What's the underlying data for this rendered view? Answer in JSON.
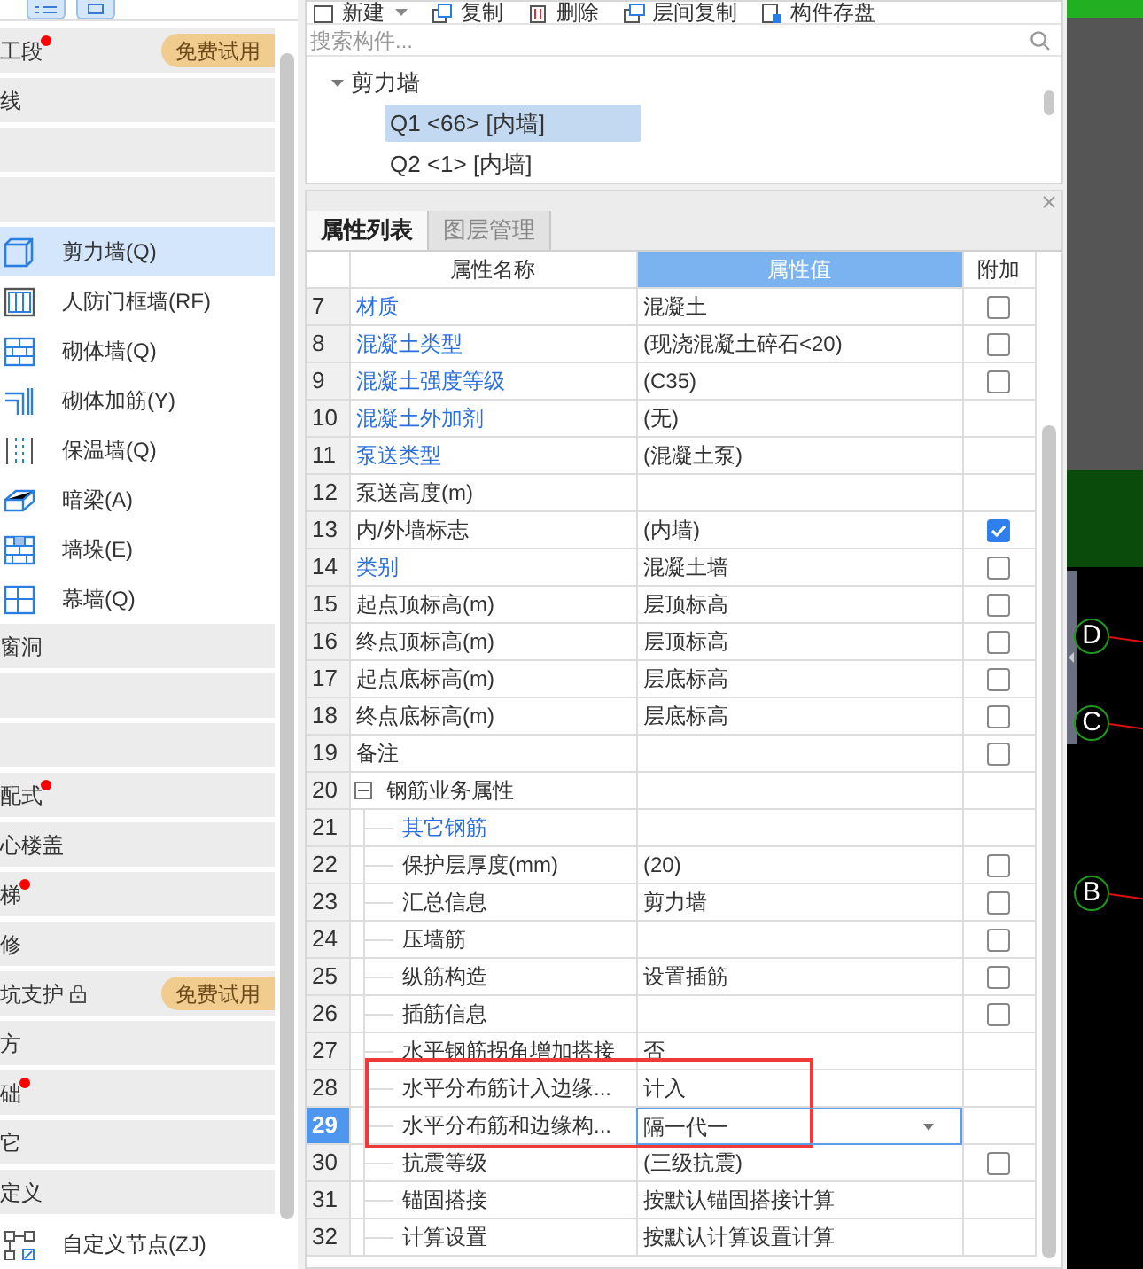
{
  "view_buttons": [
    {
      "kind": "list"
    },
    {
      "kind": "grid"
    }
  ],
  "nav": [
    {
      "kind": "category",
      "label": "工段",
      "dot": true,
      "lock": false,
      "badge": "免费试用"
    },
    {
      "kind": "category",
      "label": "线",
      "dot": false,
      "lock": false
    },
    {
      "kind": "category",
      "dot": false,
      "lock": false
    },
    {
      "kind": "category",
      "dot": false,
      "lock": false
    },
    {
      "kind": "box",
      "label": "剪力墙(Q)",
      "selected": true
    },
    {
      "kind": "frame",
      "label": "人防门框墙(RF)",
      "selected": false
    },
    {
      "kind": "brick",
      "label": "砌体墙(Q)",
      "selected": false
    },
    {
      "kind": "rebar",
      "label": "砌体加筋(Y)",
      "selected": false
    },
    {
      "kind": "dotted",
      "label": "保温墙(Q)",
      "selected": false
    },
    {
      "kind": "beam",
      "label": "暗梁(A)",
      "selected": false
    },
    {
      "kind": "pier",
      "label": "墙垛(E)",
      "selected": false
    },
    {
      "kind": "curtain",
      "label": "幕墙(Q)",
      "selected": false
    },
    {
      "kind": "category",
      "label": "窗洞",
      "dot": false,
      "lock": false
    },
    {
      "kind": "category",
      "dot": false,
      "lock": false
    },
    {
      "kind": "category",
      "dot": false,
      "lock": false
    },
    {
      "kind": "category",
      "label": "配式",
      "dot": true,
      "lock": false
    },
    {
      "kind": "category",
      "label": "心楼盖",
      "dot": false,
      "lock": false
    },
    {
      "kind": "category",
      "label": "梯",
      "dot": true,
      "lock": false
    },
    {
      "kind": "category",
      "label": "修",
      "dot": false,
      "lock": false
    },
    {
      "kind": "category",
      "label": "坑支护",
      "dot": false,
      "lock": true,
      "badge": "免费试用"
    },
    {
      "kind": "category",
      "label": "方",
      "dot": false,
      "lock": false
    },
    {
      "kind": "category",
      "label": "础",
      "dot": true,
      "lock": false
    },
    {
      "kind": "category",
      "label": "它",
      "dot": false,
      "lock": false
    },
    {
      "kind": "category",
      "label": "定义",
      "dot": false,
      "lock": false
    },
    {
      "kind": "node",
      "label": "自定义节点(ZJ)",
      "selected": false
    }
  ],
  "toolbar": [
    {
      "kind": "new",
      "label": "新建",
      "caret": true
    },
    {
      "kind": "copy",
      "label": "复制",
      "caret": false
    },
    {
      "kind": "delete",
      "label": "删除",
      "caret": false
    },
    {
      "kind": "floorcopy",
      "label": "层间复制",
      "caret": false
    },
    {
      "kind": "save",
      "label": "构件存盘",
      "caret": false
    }
  ],
  "search": {
    "placeholder": "搜索构件..."
  },
  "tree": [
    {
      "label": "剪力墙",
      "expanded": true,
      "children": [
        {
          "label": "Q1 <66> [内墙]",
          "selected": true
        },
        {
          "label": "Q2 <1> [内墙]",
          "selected": false
        }
      ]
    }
  ],
  "properties": {
    "tabs": [
      {
        "label": "属性列表",
        "selected": true
      },
      {
        "label": "图层管理",
        "selected": false
      }
    ],
    "columns": [
      "属性名称",
      "属性值",
      "附加"
    ],
    "rows": [
      {
        "num": "7",
        "name": "材质",
        "value": "混凝土",
        "link": true,
        "checked": false,
        "selected": false,
        "highlighted": false
      },
      {
        "num": "8",
        "name": "混凝土类型",
        "value": "(现浇混凝土碎石<20)",
        "link": true,
        "checked": false,
        "selected": false,
        "highlighted": false
      },
      {
        "num": "9",
        "name": "混凝土强度等级",
        "value": "(C35)",
        "link": true,
        "checked": false,
        "selected": false,
        "highlighted": false
      },
      {
        "num": "10",
        "name": "混凝土外加剂",
        "value": "(无)",
        "link": true,
        "selected": false,
        "highlighted": false
      },
      {
        "num": "11",
        "name": "泵送类型",
        "value": "(混凝土泵)",
        "link": true,
        "selected": false,
        "highlighted": false
      },
      {
        "num": "12",
        "name": "泵送高度(m)",
        "link": false,
        "selected": false,
        "highlighted": false
      },
      {
        "num": "13",
        "name": "内/外墙标志",
        "value": "(内墙)",
        "link": false,
        "checked": true,
        "selected": false,
        "highlighted": false
      },
      {
        "num": "14",
        "name": "类别",
        "value": "混凝土墙",
        "link": true,
        "checked": false,
        "selected": false,
        "highlighted": false
      },
      {
        "num": "15",
        "name": "起点顶标高(m)",
        "value": "层顶标高",
        "link": false,
        "checked": false,
        "selected": false,
        "highlighted": false
      },
      {
        "num": "16",
        "name": "终点顶标高(m)",
        "value": "层顶标高",
        "link": false,
        "checked": false,
        "selected": false,
        "highlighted": false
      },
      {
        "num": "17",
        "name": "起点底标高(m)",
        "value": "层底标高",
        "link": false,
        "checked": false,
        "selected": false,
        "highlighted": false
      },
      {
        "num": "18",
        "name": "终点底标高(m)",
        "value": "层底标高",
        "link": false,
        "checked": false,
        "selected": false,
        "highlighted": false
      },
      {
        "num": "19",
        "name": "备注",
        "link": false,
        "checked": false,
        "selected": false,
        "highlighted": false
      },
      {
        "num": "20",
        "name": "钢筋业务属性",
        "link": false,
        "selected": false,
        "highlighted": false,
        "expanded": true,
        "children": [
          {
            "num": "21",
            "name": "其它钢筋",
            "link": true,
            "selected": false,
            "highlighted": false
          },
          {
            "num": "22",
            "name": "保护层厚度(mm)",
            "value": "(20)",
            "link": false,
            "checked": false,
            "selected": false,
            "highlighted": false
          },
          {
            "num": "23",
            "name": "汇总信息",
            "value": "剪力墙",
            "link": false,
            "checked": false,
            "selected": false,
            "highlighted": false
          },
          {
            "num": "24",
            "name": "压墙筋",
            "link": false,
            "checked": false,
            "selected": false,
            "highlighted": false
          },
          {
            "num": "25",
            "name": "纵筋构造",
            "value": "设置插筋",
            "link": false,
            "checked": false,
            "selected": false,
            "highlighted": false
          },
          {
            "num": "26",
            "name": "插筋信息",
            "link": false,
            "checked": false,
            "selected": false,
            "highlighted": false
          },
          {
            "num": "27",
            "name": "水平钢筋拐角增加搭接",
            "value": "否",
            "link": false,
            "selected": false,
            "highlighted": false
          },
          {
            "num": "28",
            "name": "水平分布筋计入边缘...",
            "value": "计入",
            "link": false,
            "selected": false,
            "highlighted": true
          },
          {
            "num": "29",
            "name": "水平分布筋和边缘构...",
            "value": "隔一代一",
            "link": false,
            "selected": true,
            "highlighted": true
          },
          {
            "num": "30",
            "name": "抗震等级",
            "value": "(三级抗震)",
            "link": false,
            "checked": false,
            "selected": false,
            "highlighted": false
          },
          {
            "num": "31",
            "name": "锚固搭接",
            "value": "按默认锚固搭接计算",
            "link": false,
            "selected": false,
            "highlighted": false
          },
          {
            "num": "32",
            "name": "计算设置",
            "value": "按默认计算设置计算",
            "link": false,
            "selected": false,
            "highlighted": false
          }
        ]
      }
    ]
  },
  "canvas": {
    "axis_labels": [
      "D",
      "C",
      "B"
    ]
  }
}
